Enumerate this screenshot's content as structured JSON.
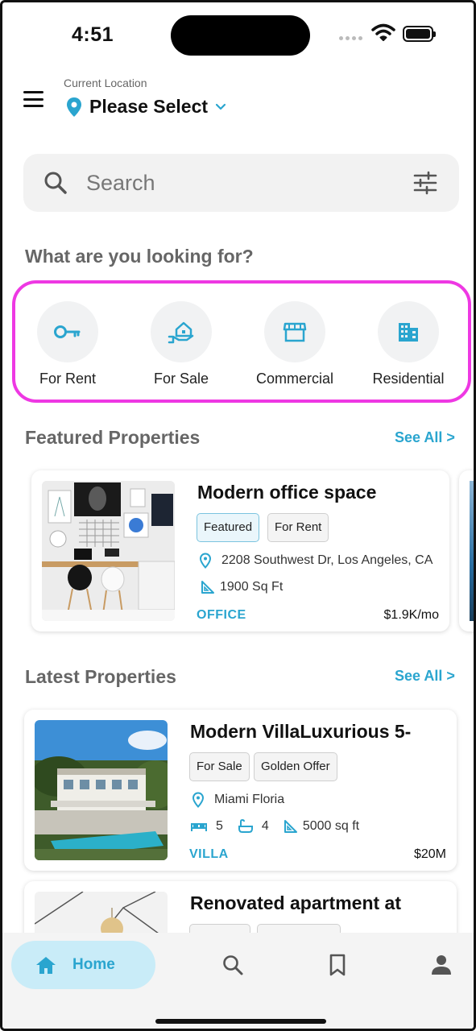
{
  "status_bar": {
    "time": "4:51"
  },
  "header": {
    "location_label": "Current Location",
    "location_value": "Please Select"
  },
  "search": {
    "placeholder": "Search"
  },
  "categories": {
    "title": "What are you looking for?",
    "items": [
      {
        "label": "For Rent",
        "icon": "key-icon"
      },
      {
        "label": "For Sale",
        "icon": "house-hand-icon"
      },
      {
        "label": "Commercial",
        "icon": "storefront-icon"
      },
      {
        "label": "Residential",
        "icon": "building-icon"
      }
    ]
  },
  "featured": {
    "title": "Featured Properties",
    "see_all": "See All >",
    "cards": [
      {
        "title": "Modern office space",
        "tags": [
          "Featured",
          "For Rent"
        ],
        "address": "2208 Southwest Dr, Los Angeles, CA",
        "area": "1900 Sq Ft",
        "type": "OFFICE",
        "price": "$1.9K/mo"
      }
    ]
  },
  "latest": {
    "title": "Latest Properties",
    "see_all": "See All >",
    "cards": [
      {
        "title": "Modern VillaLuxurious 5-",
        "tags": [
          "For Sale",
          "Golden Offer"
        ],
        "address": "Miami Floria",
        "beds": "5",
        "baths": "4",
        "area": "5000 sq ft",
        "type": "VILLA",
        "price": "$20M"
      },
      {
        "title": "Renovated apartment at"
      }
    ]
  },
  "bottom_nav": {
    "home_label": "Home",
    "items": [
      "search-icon",
      "bookmark-icon",
      "profile-icon"
    ]
  },
  "colors": {
    "accent": "#2aa5cf",
    "highlight_border": "#ee38e3",
    "home_pill": "#c9ecf8"
  }
}
